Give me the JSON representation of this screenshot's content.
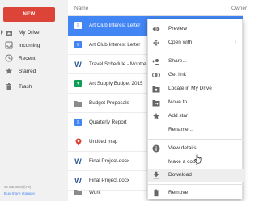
{
  "sidebar": {
    "new_label": "NEW",
    "items": [
      {
        "label": "My Drive",
        "icon": "drive-icon"
      },
      {
        "label": "Incoming",
        "icon": "inbox-icon"
      },
      {
        "label": "Recent",
        "icon": "clock-icon"
      },
      {
        "label": "Starred",
        "icon": "star-icon"
      },
      {
        "label": "Trash",
        "icon": "trash-icon"
      }
    ],
    "storage_text": "44 MB used (0%)",
    "storage_link": "Buy more storage"
  },
  "list": {
    "header_name": "Name",
    "header_sort_arrow": "↑",
    "header_owner": "Owner",
    "rows": [
      {
        "name": "Art Club Interest Letter",
        "type": "doc",
        "selected": true
      },
      {
        "name": "Art Club Interest Letter",
        "type": "doc",
        "selected": false
      },
      {
        "name": "Travel Schedule - Montre",
        "type": "word",
        "selected": false
      },
      {
        "name": "Art Supply Budget 2015",
        "type": "sheet",
        "selected": false
      },
      {
        "name": "Budget Proposals",
        "type": "folder",
        "selected": false
      },
      {
        "name": "Quarterly Report",
        "type": "doc",
        "selected": false
      },
      {
        "name": "Untitled map",
        "type": "map",
        "selected": false
      },
      {
        "name": "Final Project.docx",
        "type": "word",
        "selected": false
      },
      {
        "name": "Final Project.docx",
        "type": "word",
        "selected": false
      },
      {
        "name": "Work",
        "type": "folder",
        "selected": false
      }
    ]
  },
  "context_menu": {
    "items": [
      {
        "label": "Preview",
        "icon": "eye-icon"
      },
      {
        "label": "Open with",
        "icon": "open-with-icon",
        "chevron": "›"
      },
      {
        "label": "Share...",
        "icon": "person-add-icon"
      },
      {
        "label": "Get link",
        "icon": "link-icon"
      },
      {
        "label": "Locate in My Drive",
        "icon": "locate-icon"
      },
      {
        "label": "Move to...",
        "icon": "move-folder-icon"
      },
      {
        "label": "Add star",
        "icon": "star-icon"
      },
      {
        "label": "Rename...",
        "icon": ""
      },
      {
        "label": "View details",
        "icon": "info-icon"
      },
      {
        "label": "Make a copy",
        "icon": ""
      },
      {
        "label": "Download",
        "icon": "download-icon",
        "hover": true
      },
      {
        "label": "Remove",
        "icon": "trash-icon"
      }
    ]
  },
  "colors": {
    "new_button": "#db4437",
    "selected_row": "#4285f4",
    "doc_blue": "#4285f4",
    "sheet_green": "#0f9d58",
    "word_blue": "#2b579a"
  }
}
